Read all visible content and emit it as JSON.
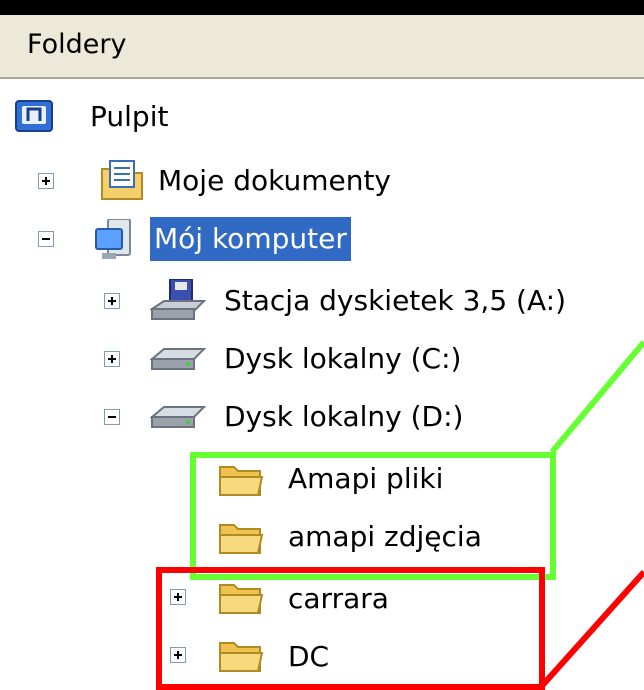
{
  "header": {
    "title": "Foldery"
  },
  "tree": {
    "desktop": "Pulpit",
    "my_documents": "Moje dokumenty",
    "my_computer": "Mój komputer",
    "floppy": "Stacja dyskietek 3,5 (A:)",
    "drive_c": "Dysk lokalny (C:)",
    "drive_d": "Dysk lokalny (D:)",
    "folders": [
      "Amapi pliki",
      "amapi zdjęcia",
      "carrara",
      "DC"
    ]
  },
  "colors": {
    "selection": "#316ac5",
    "annotation_green": "#66ff33",
    "annotation_red": "#ff0000",
    "folder": "#f5d06a"
  },
  "icons": {
    "desktop": "desktop-icon",
    "documents": "my-documents-icon",
    "computer": "my-computer-icon",
    "floppy": "floppy-drive-icon",
    "drive": "hard-drive-icon",
    "folder": "folder-icon"
  }
}
